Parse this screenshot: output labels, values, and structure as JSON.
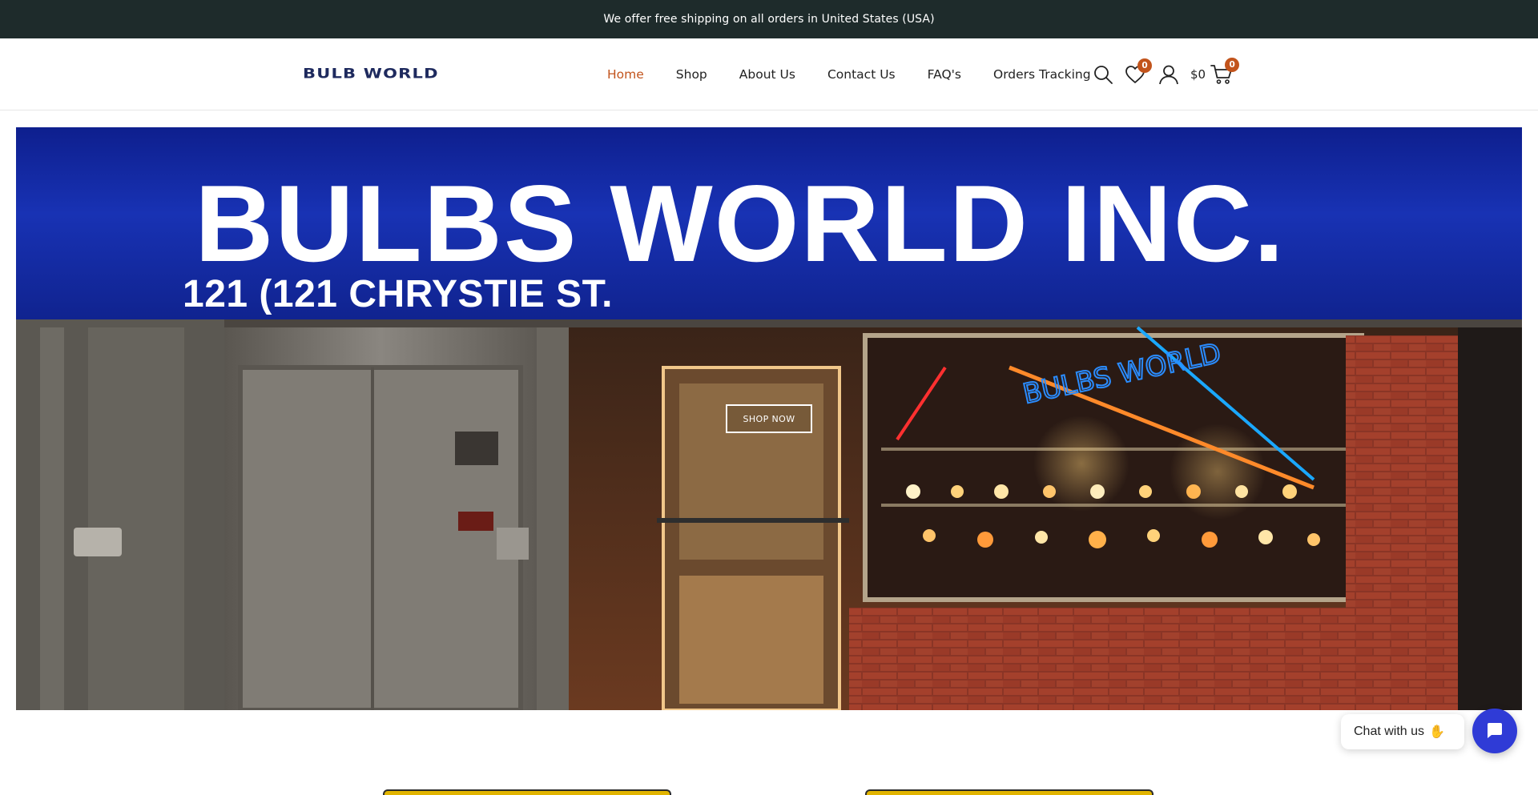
{
  "announcement": "We offer free shipping on all orders in United States (USA)",
  "logo": {
    "text": "BULB WORLD"
  },
  "nav": {
    "items": [
      {
        "label": "Home",
        "active": true
      },
      {
        "label": "Shop",
        "active": false
      },
      {
        "label": "About Us",
        "active": false
      },
      {
        "label": "Contact Us",
        "active": false
      },
      {
        "label": "FAQ's",
        "active": false
      },
      {
        "label": "Orders Tracking",
        "active": false
      }
    ]
  },
  "header_icons": {
    "search": "search-icon",
    "wishlist": {
      "icon": "heart-icon",
      "count": "0"
    },
    "account": "user-icon",
    "cart": {
      "icon": "cart-icon",
      "total": "$0",
      "count": "0"
    }
  },
  "hero": {
    "sign_title": "BULBS WORLD INC.",
    "sign_address": "121 (121 CHRYSTIE ST.",
    "neon_text": "BULBS WORLD",
    "cta_label": "SHOP NOW"
  },
  "chat": {
    "label": "Chat with us",
    "wave_icon": "waving-hand-icon",
    "fab_icon": "chat-bubble-icon"
  },
  "colors": {
    "topbar_bg": "#1e2b2b",
    "accent": "#c2541c",
    "logo": "#1e2a5e",
    "chat_fab": "#2f3bd6"
  }
}
